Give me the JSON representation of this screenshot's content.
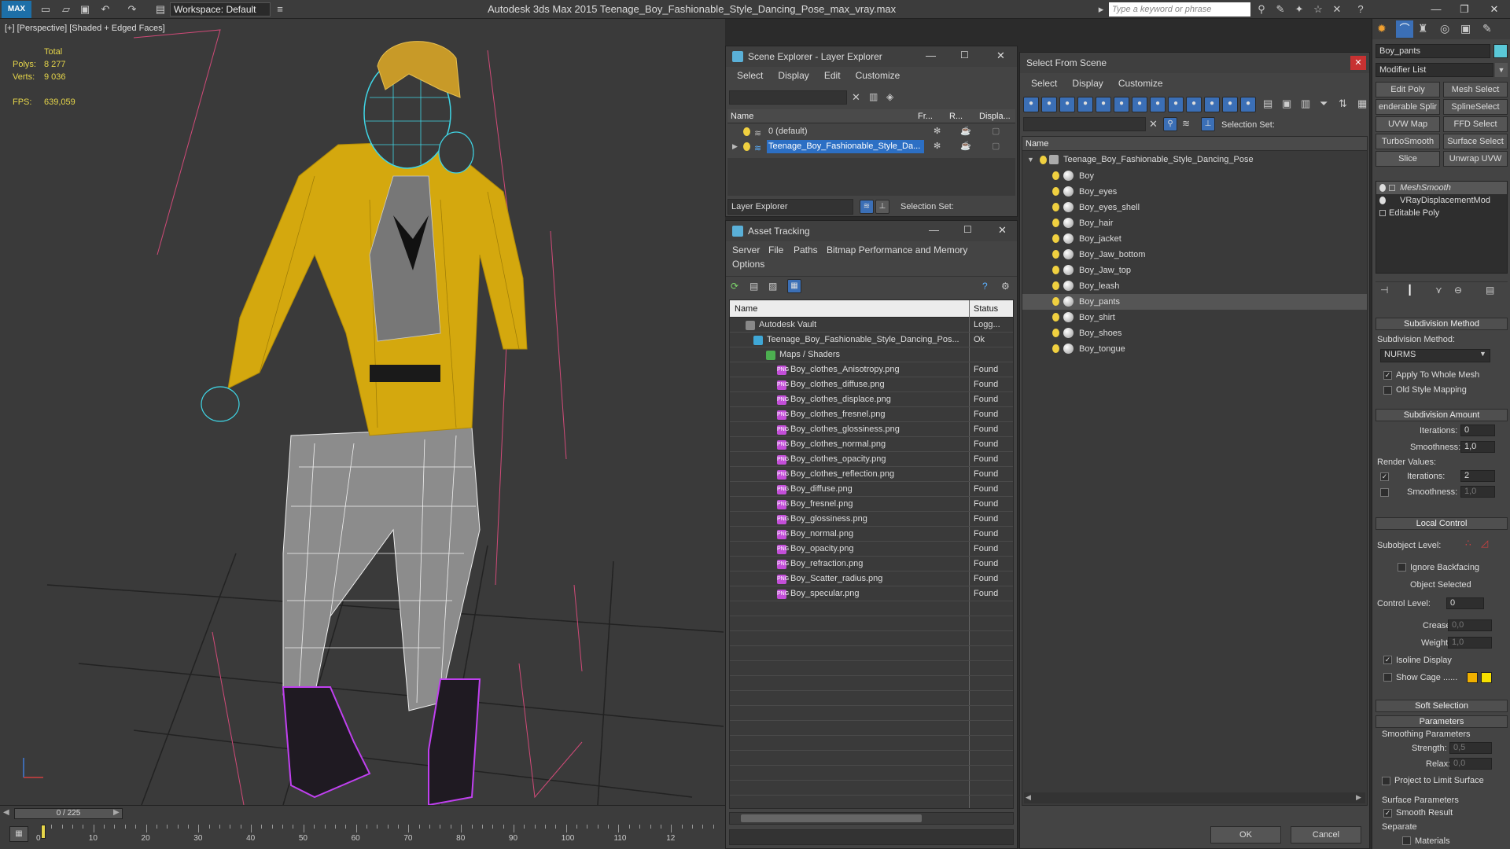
{
  "titlebar": {
    "logo": "MAX",
    "workspace_label": "Workspace: Default",
    "app_title": "Autodesk 3ds Max  2015     Teenage_Boy_Fashionable_Style_Dancing_Pose_max_vray.max",
    "search_placeholder": "Type a keyword or phrase"
  },
  "viewport": {
    "label": "[+] [Perspective] [Shaded + Edged Faces]",
    "stats": {
      "total_label": "Total",
      "polys_label": "Polys:",
      "polys_value": "8 277",
      "verts_label": "Verts:",
      "verts_value": "9 036",
      "fps_label": "FPS:",
      "fps_value": "639,059"
    }
  },
  "timeline": {
    "frame": "0 / 225",
    "ticks": [
      "0",
      "10",
      "20",
      "30",
      "40",
      "50",
      "60",
      "70",
      "80",
      "90",
      "100",
      "110",
      "12"
    ]
  },
  "scene_explorer": {
    "title": "Scene Explorer - Layer Explorer",
    "menus": [
      "Select",
      "Display",
      "Edit",
      "Customize"
    ],
    "columns": [
      "Name",
      "Fr...",
      "R...",
      "Displa..."
    ],
    "layers": [
      "0 (default)",
      "Teenage_Boy_Fashionable_Style_Da..."
    ],
    "footer_dropdown": "Layer Explorer",
    "selection_set_label": "Selection Set:"
  },
  "asset_tracking": {
    "title": "Asset Tracking",
    "menus": [
      "Server",
      "File",
      "Paths",
      "Bitmap Performance and Memory",
      "Options"
    ],
    "columns": [
      "Name",
      "Status"
    ],
    "rows": [
      {
        "name": "Autodesk Vault",
        "status": "Logg..."
      },
      {
        "name": "Teenage_Boy_Fashionable_Style_Dancing_Pos...",
        "status": "Ok"
      },
      {
        "name": "Maps / Shaders",
        "status": ""
      },
      {
        "name": "Boy_clothes_Anisotropy.png",
        "status": "Found"
      },
      {
        "name": "Boy_clothes_diffuse.png",
        "status": "Found"
      },
      {
        "name": "Boy_clothes_displace.png",
        "status": "Found"
      },
      {
        "name": "Boy_clothes_fresnel.png",
        "status": "Found"
      },
      {
        "name": "Boy_clothes_glossiness.png",
        "status": "Found"
      },
      {
        "name": "Boy_clothes_normal.png",
        "status": "Found"
      },
      {
        "name": "Boy_clothes_opacity.png",
        "status": "Found"
      },
      {
        "name": "Boy_clothes_reflection.png",
        "status": "Found"
      },
      {
        "name": "Boy_diffuse.png",
        "status": "Found"
      },
      {
        "name": "Boy_fresnel.png",
        "status": "Found"
      },
      {
        "name": "Boy_glossiness.png",
        "status": "Found"
      },
      {
        "name": "Boy_normal.png",
        "status": "Found"
      },
      {
        "name": "Boy_opacity.png",
        "status": "Found"
      },
      {
        "name": "Boy_refraction.png",
        "status": "Found"
      },
      {
        "name": "Boy_Scatter_radius.png",
        "status": "Found"
      },
      {
        "name": "Boy_specular.png",
        "status": "Found"
      }
    ]
  },
  "select_from_scene": {
    "title": "Select From Scene",
    "menus": [
      "Select",
      "Display",
      "Customize"
    ],
    "selection_set_label": "Selection Set:",
    "column": "Name",
    "root": "Teenage_Boy_Fashionable_Style_Dancing_Pose",
    "objects": [
      "Boy",
      "Boy_eyes",
      "Boy_eyes_shell",
      "Boy_hair",
      "Boy_jacket",
      "Boy_Jaw_bottom",
      "Boy_Jaw_top",
      "Boy_leash",
      "Boy_pants",
      "Boy_shirt",
      "Boy_shoes",
      "Boy_tongue"
    ],
    "ok_label": "OK",
    "cancel_label": "Cancel"
  },
  "command_panel": {
    "object_name": "Boy_pants",
    "modifier_list": "Modifier List",
    "buttons": [
      "Edit Poly",
      "Mesh Select",
      "enderable Splir",
      "SplineSelect",
      "UVW Map",
      "FFD Select",
      "TurboSmooth",
      "Surface Select",
      "Slice",
      "Unwrap UVW"
    ],
    "stack": [
      "MeshSmooth",
      "VRayDisplacementMod",
      "Editable Poly"
    ],
    "subdivision_method": {
      "title": "Subdivision Method",
      "label": "Subdivision Method:",
      "value": "NURMS",
      "apply_whole_mesh": "Apply To Whole Mesh",
      "old_style": "Old Style Mapping"
    },
    "subdivision_amount": {
      "title": "Subdivision Amount",
      "iterations_label": "Iterations:",
      "iterations_value": "0",
      "smoothness_label": "Smoothness:",
      "smoothness_value": "1,0",
      "render_values": "Render Values:",
      "r_iterations_label": "Iterations:",
      "r_iterations_value": "2",
      "r_smoothness_label": "Smoothness:",
      "r_smoothness_value": "1,0"
    },
    "local_control": {
      "title": "Local Control",
      "subobject_label": "Subobject Level:",
      "ignore_backfacing": "Ignore Backfacing",
      "object_selected": "Object Selected",
      "control_level_label": "Control Level:",
      "control_level_value": "0",
      "crease_label": "Crease:",
      "crease_value": "0,0",
      "weight_label": "Weight:",
      "weight_value": "1,0",
      "isoline": "Isoline Display",
      "show_cage": "Show Cage ......"
    },
    "soft_selection": "Soft Selection",
    "parameters": {
      "title": "Parameters",
      "smoothing": "Smoothing Parameters",
      "strength_label": "Strength:",
      "strength_value": "0,5",
      "relax_label": "Relax:",
      "relax_value": "0,0",
      "project": "Project to Limit Surface",
      "surface": "Surface Parameters",
      "smooth_result": "Smooth Result",
      "separate": "Separate",
      "materials": "Materials"
    }
  },
  "colors": {
    "jacket": "#d4a80e",
    "wire_cyan": "#3fd6e6",
    "shoes": "#b23be0",
    "accent_blue": "#3b6fb6"
  }
}
